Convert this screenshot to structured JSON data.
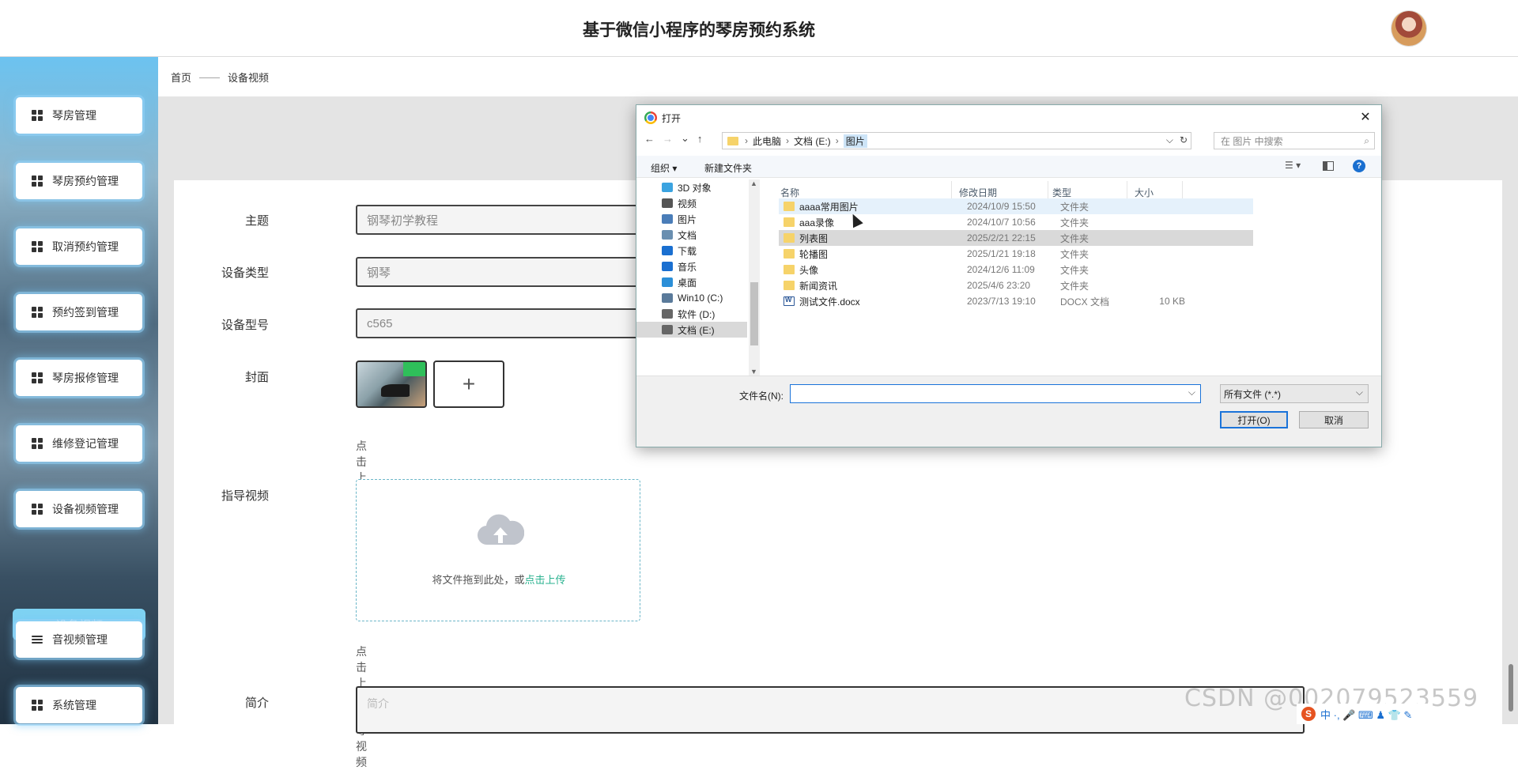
{
  "header": {
    "title": "基于微信小程序的琴房预约系统"
  },
  "sidebar": {
    "items": [
      {
        "label": "琴房管理"
      },
      {
        "label": "琴房预约管理"
      },
      {
        "label": "取消预约管理"
      },
      {
        "label": "预约签到管理"
      },
      {
        "label": "琴房报修管理"
      },
      {
        "label": "维修登记管理"
      },
      {
        "label": "设备视频管理"
      },
      {
        "label": "音视频管理"
      },
      {
        "label": "系统管理"
      }
    ],
    "active_sub": "设备视频"
  },
  "breadcrumb": {
    "home": "首页",
    "sep": "——",
    "current": "设备视频"
  },
  "form": {
    "subject_label": "主题",
    "subject_value": "钢琴初学教程",
    "type_label": "设备类型",
    "type_value": "钢琴",
    "model_label": "设备型号",
    "model_value": "c565",
    "cover_label": "封面",
    "cover_add": "+",
    "cover_hint": "点击上传封面",
    "video_label": "指导视频",
    "video_drop": "将文件拖到此处，或",
    "video_link": "点击上传",
    "video_hint": "点击上传指导视频",
    "intro_label": "简介",
    "intro_placeholder": "简介"
  },
  "dialog": {
    "title": "打开",
    "close": "✕",
    "nav": [
      "←",
      "→",
      "⌄",
      "↑"
    ],
    "path": [
      "此电脑",
      "文档 (E:)",
      "图片"
    ],
    "search_placeholder": "在 图片 中搜索",
    "organize": "组织 ▾",
    "new_folder": "新建文件夹",
    "help": "?",
    "nav_items": [
      {
        "label": "3D 对象",
        "color": "#3ba3e0"
      },
      {
        "label": "视频",
        "color": "#555555"
      },
      {
        "label": "图片",
        "color": "#4a7db8"
      },
      {
        "label": "文档",
        "color": "#6a8fb0"
      },
      {
        "label": "下载",
        "color": "#1a6fd0"
      },
      {
        "label": "音乐",
        "color": "#1a6fd0"
      },
      {
        "label": "桌面",
        "color": "#2b8fd8"
      },
      {
        "label": "Win10 (C:)",
        "color": "#5a7a9a"
      },
      {
        "label": "软件 (D:)",
        "color": "#666666"
      },
      {
        "label": "文档 (E:)",
        "color": "#666666"
      }
    ],
    "columns": {
      "name": "名称",
      "date": "修改日期",
      "type": "类型",
      "size": "大小"
    },
    "files": [
      {
        "name": "aaaa常用图片",
        "date": "2024/10/9 15:50",
        "type": "文件夹",
        "size": "",
        "kind": "folder"
      },
      {
        "name": "aaa录像",
        "date": "2024/10/7 10:56",
        "type": "文件夹",
        "size": "",
        "kind": "folder"
      },
      {
        "name": "列表图",
        "date": "2025/2/21 22:15",
        "type": "文件夹",
        "size": "",
        "kind": "folder"
      },
      {
        "name": "轮播图",
        "date": "2025/1/21 19:18",
        "type": "文件夹",
        "size": "",
        "kind": "folder"
      },
      {
        "name": "头像",
        "date": "2024/12/6 11:09",
        "type": "文件夹",
        "size": "",
        "kind": "folder"
      },
      {
        "name": "新闻资讯",
        "date": "2025/4/6 23:20",
        "type": "文件夹",
        "size": "",
        "kind": "folder"
      },
      {
        "name": "测试文件.docx",
        "date": "2023/7/13 19:10",
        "type": "DOCX 文档",
        "size": "10 KB",
        "kind": "doc"
      }
    ],
    "filename_label": "文件名(N):",
    "filetype": "所有文件 (*.*)",
    "open": "打开(O)",
    "cancel": "取消"
  },
  "watermark": "CSDN @002079523559",
  "ime": {
    "logo": "S",
    "text": "中 ·, 🎤 ⌨ ♟ 👕 ✎"
  }
}
